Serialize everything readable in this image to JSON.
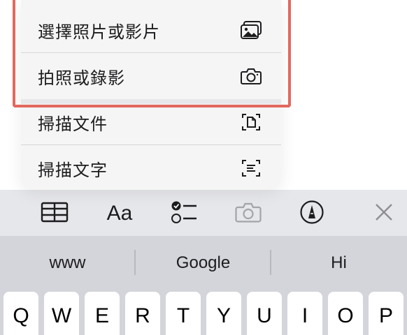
{
  "menu": {
    "items": [
      {
        "label": "選擇照片或影片",
        "icon": "photo-library-icon"
      },
      {
        "label": "拍照或錄影",
        "icon": "camera-icon"
      },
      {
        "label": "掃描文件",
        "icon": "scan-document-icon"
      },
      {
        "label": "掃描文字",
        "icon": "scan-text-icon"
      }
    ]
  },
  "toolbar": {
    "format_label": "Aa",
    "tools": [
      "table-icon",
      "format-text-icon",
      "checklist-icon",
      "camera-icon",
      "markup-pen-icon",
      "close-icon"
    ]
  },
  "keyboard": {
    "suggestions": [
      "www",
      "Google",
      "Hi"
    ],
    "keys": [
      "Q",
      "W",
      "E",
      "R",
      "T",
      "Y",
      "U",
      "I",
      "O",
      "P"
    ]
  },
  "colors": {
    "highlight": "#e2685e",
    "menu_bg": "#f5f5f6",
    "toolbar_bg": "#e6e7ea",
    "keyboard_bg": "#d4d5da"
  }
}
